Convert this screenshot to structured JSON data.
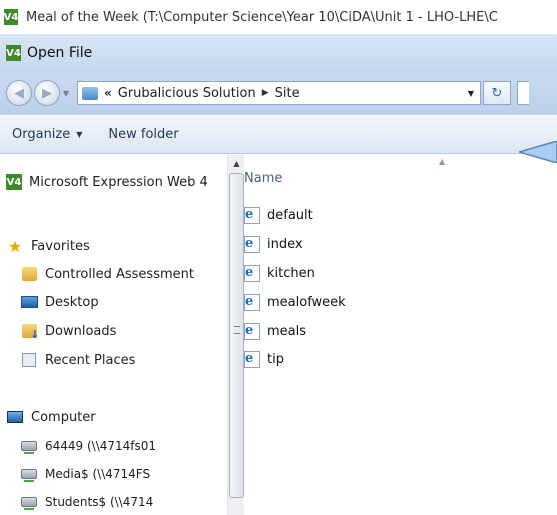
{
  "app_window": {
    "icon_label": "V4",
    "title": "Meal of the Week (T:\\Computer Science\\Year 10\\CiDA\\Unit 1 - LHO-LHE\\C"
  },
  "dialog": {
    "icon_label": "V4",
    "title": "Open File"
  },
  "address_bar": {
    "overflow_marker": "«",
    "segments": [
      "Grubalicious Solution",
      "Site"
    ],
    "separator": "▶"
  },
  "toolbar": {
    "organize_label": "Organize",
    "new_folder_label": "New folder"
  },
  "nav_pane": {
    "items": [
      {
        "label": "Microsoft Expression Web 4",
        "icon": "expression-web-icon"
      },
      {
        "label": "Favorites",
        "icon": "star-icon"
      },
      {
        "label": "Controlled Assessment",
        "icon": "folder-icon"
      },
      {
        "label": "Desktop",
        "icon": "desktop-icon"
      },
      {
        "label": "Downloads",
        "icon": "downloads-icon"
      },
      {
        "label": "Recent Places",
        "icon": "recent-places-icon"
      },
      {
        "label": "Computer",
        "icon": "computer-icon"
      },
      {
        "label": "64449 (\\\\4714fs01",
        "icon": "network-drive-icon"
      },
      {
        "label": "Media$ (\\\\4714FS",
        "icon": "network-drive-icon"
      },
      {
        "label": "Students$ (\\\\4714",
        "icon": "network-drive-icon"
      }
    ]
  },
  "file_list": {
    "column_name": "Name",
    "files": [
      "default",
      "index",
      "kitchen",
      "mealofweek",
      "meals",
      "tip"
    ]
  },
  "colors": {
    "toolbar_text": "#1e395b",
    "callout_fill": "#a8cdf0",
    "callout_stroke": "#5b86b8"
  }
}
